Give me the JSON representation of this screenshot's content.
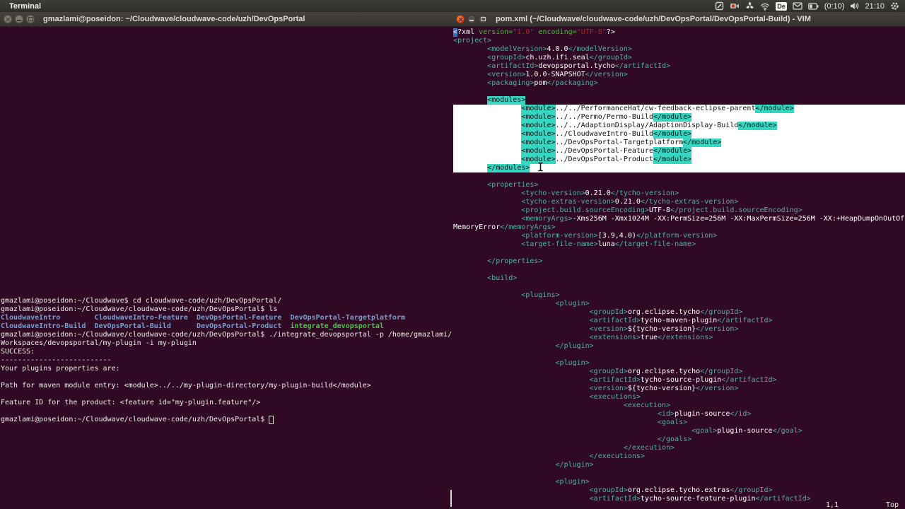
{
  "panel": {
    "app_name": "Terminal",
    "keyboard_layout": "De",
    "battery_time": "(0:10)",
    "clock": "21:10"
  },
  "colors": {
    "terminal_background": "#300a24",
    "panel_background": "#3e3c37",
    "selection_white": "#ffffff",
    "selection_cyan": "#35d7c2",
    "xml_tag_teal": "#4db3a4",
    "directory_blue": "#729fcf",
    "executable_green": "#3ecb3e",
    "attr_green": "#50b43e",
    "string_red": "#9e2b2b",
    "vim_cursor_blue": "#3d6fc0",
    "close_button_orange": "#d8451d"
  },
  "left_window": {
    "title": "gmazlami@poseidon: ~/Cloudwave/cloudwave-code/uzh/DevOpsPortal",
    "lines": [
      {
        "s": [
          [
            "p",
            "gmazlami@poseidon:~/Cloudwave$ cd cloudwave-code/uzh/DevOpsPortal/"
          ]
        ]
      },
      {
        "s": [
          [
            "p",
            "gmazlami@poseidon:~/Cloudwave/cloudwave-code/uzh/DevOpsPortal$ ls"
          ]
        ]
      },
      {
        "s": [
          [
            "d",
            "CloudwaveIntro"
          ],
          [
            "p",
            "        "
          ],
          [
            "d",
            "CloudwaveIntro-Feature"
          ],
          [
            "p",
            "  "
          ],
          [
            "d",
            "DevOpsPortal-Feature"
          ],
          [
            "p",
            "  "
          ],
          [
            "d",
            "DevOpsPortal-Targetplatform"
          ]
        ]
      },
      {
        "s": [
          [
            "d",
            "CloudwaveIntro-Build"
          ],
          [
            "p",
            "  "
          ],
          [
            "d",
            "DevOpsPortal-Build"
          ],
          [
            "p",
            "      "
          ],
          [
            "d",
            "DevOpsPortal-Product"
          ],
          [
            "p",
            "  "
          ],
          [
            "x",
            "integrate_devopsportal"
          ]
        ]
      },
      {
        "s": [
          [
            "p",
            "gmazlami@poseidon:~/Cloudwave/cloudwave-code/uzh/DevOpsPortal$ ./integrate_devopsportal -p /home/gmazlami/"
          ]
        ]
      },
      {
        "s": [
          [
            "p",
            "Workspaces/devopsportal/my-plugin -i my-plugin"
          ]
        ]
      },
      {
        "s": [
          [
            "p",
            "SUCCESS:"
          ]
        ]
      },
      {
        "s": [
          [
            "p",
            "--------------------------"
          ]
        ]
      },
      {
        "s": [
          [
            "p",
            "Your plugins properties are:"
          ]
        ]
      },
      {
        "s": []
      },
      {
        "s": [
          [
            "p",
            "Path for maven module entry: <module>../../my-plugin-directory/my-plugin-build</module>"
          ]
        ]
      },
      {
        "s": []
      },
      {
        "s": [
          [
            "p",
            "Feature ID for the product: <feature id=\"my-plugin.feature\"/>"
          ]
        ]
      },
      {
        "s": []
      },
      {
        "s": [
          [
            "p",
            "gmazlami@poseidon:~/Cloudwave/cloudwave-code/uzh/DevOpsPortal$ "
          ],
          [
            "hcur",
            ""
          ]
        ]
      }
    ]
  },
  "right_window": {
    "title": "pom.xml (~/Cloudwave/cloudwave-code/uzh/DevOpsPortal/DevOpsPortal-Build) - VIM",
    "status": {
      "cursor_pos": "1,1",
      "scroll_pos": "Top"
    },
    "lines": [
      {
        "s": [
          [
            "cur",
            "<"
          ],
          [
            "w",
            "?xml "
          ],
          [
            "g",
            "version="
          ],
          [
            "r",
            "\"1.0\""
          ],
          [
            "w",
            " "
          ],
          [
            "g",
            "encoding="
          ],
          [
            "r",
            "\"UTF-8\""
          ],
          [
            "w",
            "?>"
          ]
        ]
      },
      {
        "s": [
          [
            "t",
            "<project>"
          ]
        ]
      },
      {
        "s": [
          [
            "w",
            "        "
          ],
          [
            "t",
            "<modelVersion>"
          ],
          [
            "w",
            "4.0.0"
          ],
          [
            "t",
            "</modelVersion>"
          ]
        ]
      },
      {
        "s": [
          [
            "w",
            "        "
          ],
          [
            "t",
            "<groupId>"
          ],
          [
            "w",
            "ch.uzh.ifi.seal"
          ],
          [
            "t",
            "</groupId>"
          ]
        ]
      },
      {
        "s": [
          [
            "w",
            "        "
          ],
          [
            "t",
            "<artifactId>"
          ],
          [
            "w",
            "devopsportal.tycho"
          ],
          [
            "t",
            "</artifactId>"
          ]
        ]
      },
      {
        "s": [
          [
            "w",
            "        "
          ],
          [
            "t",
            "<version>"
          ],
          [
            "w",
            "1.0.0-SNAPSHOT"
          ],
          [
            "t",
            "</version>"
          ]
        ]
      },
      {
        "s": [
          [
            "w",
            "        "
          ],
          [
            "t",
            "<packaging>"
          ],
          [
            "w",
            "pom"
          ],
          [
            "t",
            "</packaging>"
          ]
        ]
      },
      {
        "s": []
      },
      {
        "s": [
          [
            "w",
            "        "
          ],
          [
            "st",
            "<modules>"
          ],
          [
            "fillsel",
            ""
          ]
        ]
      },
      {
        "cls": "sel",
        "s": [
          [
            "sw",
            "                "
          ],
          [
            "st",
            "<module>"
          ],
          [
            "sw",
            "../../PerformanceHat/cw-feedback-eclipse-parent"
          ],
          [
            "st",
            "</module>"
          ]
        ]
      },
      {
        "cls": "sel",
        "s": [
          [
            "sw",
            "                "
          ],
          [
            "st",
            "<module>"
          ],
          [
            "sw",
            "../../Permo/Permo-Build"
          ],
          [
            "st",
            "</module>"
          ]
        ]
      },
      {
        "cls": "sel",
        "s": [
          [
            "sw",
            "                "
          ],
          [
            "st",
            "<module>"
          ],
          [
            "sw",
            "../../AdaptionDisplay/AdaptionDisplay-Build"
          ],
          [
            "st",
            "</module>"
          ]
        ]
      },
      {
        "cls": "sel",
        "s": [
          [
            "sw",
            "                "
          ],
          [
            "st",
            "<module>"
          ],
          [
            "sw",
            "../CloudwaveIntro-Build"
          ],
          [
            "st",
            "</module>"
          ]
        ]
      },
      {
        "cls": "sel",
        "s": [
          [
            "sw",
            "                "
          ],
          [
            "st",
            "<module>"
          ],
          [
            "sw",
            "../DevOpsPortal-Targetplatform"
          ],
          [
            "st",
            "</module>"
          ]
        ]
      },
      {
        "cls": "sel",
        "s": [
          [
            "sw",
            "                "
          ],
          [
            "st",
            "<module>"
          ],
          [
            "sw",
            "../DevOpsPortal-Feature"
          ],
          [
            "st",
            "</module>"
          ]
        ]
      },
      {
        "cls": "sel",
        "s": [
          [
            "sw",
            "                "
          ],
          [
            "st",
            "<module>"
          ],
          [
            "sw",
            "../DevOpsPortal-Product"
          ],
          [
            "st",
            "</module>"
          ]
        ]
      },
      {
        "cls": "sel",
        "s": [
          [
            "sw",
            "        "
          ],
          [
            "st",
            "</modules>"
          ]
        ]
      },
      {
        "s": []
      },
      {
        "s": [
          [
            "w",
            "        "
          ],
          [
            "t",
            "<properties>"
          ]
        ]
      },
      {
        "s": [
          [
            "w",
            "                "
          ],
          [
            "t",
            "<tycho-version>"
          ],
          [
            "w",
            "0.21.0"
          ],
          [
            "t",
            "</tycho-version>"
          ]
        ]
      },
      {
        "s": [
          [
            "w",
            "                "
          ],
          [
            "t",
            "<tycho-extras-version>"
          ],
          [
            "w",
            "0.21.0"
          ],
          [
            "t",
            "</tycho-extras-version>"
          ]
        ]
      },
      {
        "s": [
          [
            "w",
            "                "
          ],
          [
            "t",
            "<project.build.sourceEncoding>"
          ],
          [
            "w",
            "UTF-8"
          ],
          [
            "t",
            "</project.build.sourceEncoding>"
          ]
        ]
      },
      {
        "s": [
          [
            "w",
            "                "
          ],
          [
            "t",
            "<memoryArgs>"
          ],
          [
            "w",
            "-Xms256M -Xmx1024M -XX:PermSize=256M -XX:MaxPermSize=256M -XX:+HeapDumpOnOutOf"
          ]
        ]
      },
      {
        "s": [
          [
            "w",
            "MemoryError"
          ],
          [
            "t",
            "</memoryArgs>"
          ]
        ]
      },
      {
        "s": [
          [
            "w",
            "                "
          ],
          [
            "t",
            "<platform-version>"
          ],
          [
            "w",
            "[3.9,4.0)"
          ],
          [
            "t",
            "</platform-version>"
          ]
        ]
      },
      {
        "s": [
          [
            "w",
            "                "
          ],
          [
            "t",
            "<target-file-name>"
          ],
          [
            "w",
            "luna"
          ],
          [
            "t",
            "</target-file-name>"
          ]
        ]
      },
      {
        "s": []
      },
      {
        "s": [
          [
            "w",
            "        "
          ],
          [
            "t",
            "</properties>"
          ]
        ]
      },
      {
        "s": []
      },
      {
        "s": [
          [
            "w",
            "        "
          ],
          [
            "t",
            "<build>"
          ]
        ]
      },
      {
        "s": []
      },
      {
        "s": [
          [
            "w",
            "                "
          ],
          [
            "t",
            "<plugins>"
          ]
        ]
      },
      {
        "s": [
          [
            "w",
            "                        "
          ],
          [
            "t",
            "<plugin>"
          ]
        ]
      },
      {
        "s": [
          [
            "w",
            "                                "
          ],
          [
            "t",
            "<groupId>"
          ],
          [
            "w",
            "org.eclipse.tycho"
          ],
          [
            "t",
            "</groupId>"
          ]
        ]
      },
      {
        "s": [
          [
            "w",
            "                                "
          ],
          [
            "t",
            "<artifactId>"
          ],
          [
            "w",
            "tycho-maven-plugin"
          ],
          [
            "t",
            "</artifactId>"
          ]
        ]
      },
      {
        "s": [
          [
            "w",
            "                                "
          ],
          [
            "t",
            "<version>"
          ],
          [
            "w",
            "${tycho-version}"
          ],
          [
            "t",
            "</version>"
          ]
        ]
      },
      {
        "s": [
          [
            "w",
            "                                "
          ],
          [
            "t",
            "<extensions>"
          ],
          [
            "w",
            "true"
          ],
          [
            "t",
            "</extensions>"
          ]
        ]
      },
      {
        "s": [
          [
            "w",
            "                        "
          ],
          [
            "t",
            "</plugin>"
          ]
        ]
      },
      {
        "s": []
      },
      {
        "s": [
          [
            "w",
            "                        "
          ],
          [
            "t",
            "<plugin>"
          ]
        ]
      },
      {
        "s": [
          [
            "w",
            "                                "
          ],
          [
            "t",
            "<groupId>"
          ],
          [
            "w",
            "org.eclipse.tycho"
          ],
          [
            "t",
            "</groupId>"
          ]
        ]
      },
      {
        "s": [
          [
            "w",
            "                                "
          ],
          [
            "t",
            "<artifactId>"
          ],
          [
            "w",
            "tycho-source-plugin"
          ],
          [
            "t",
            "</artifactId>"
          ]
        ]
      },
      {
        "s": [
          [
            "w",
            "                                "
          ],
          [
            "t",
            "<version>"
          ],
          [
            "w",
            "${tycho-version}"
          ],
          [
            "t",
            "</version>"
          ]
        ]
      },
      {
        "s": [
          [
            "w",
            "                                "
          ],
          [
            "t",
            "<executions>"
          ]
        ]
      },
      {
        "s": [
          [
            "w",
            "                                        "
          ],
          [
            "t",
            "<execution>"
          ]
        ]
      },
      {
        "s": [
          [
            "w",
            "                                                "
          ],
          [
            "t",
            "<id>"
          ],
          [
            "w",
            "plugin-source"
          ],
          [
            "t",
            "</id>"
          ]
        ]
      },
      {
        "s": [
          [
            "w",
            "                                                "
          ],
          [
            "t",
            "<goals>"
          ]
        ]
      },
      {
        "s": [
          [
            "w",
            "                                                        "
          ],
          [
            "t",
            "<goal>"
          ],
          [
            "w",
            "plugin-source"
          ],
          [
            "t",
            "</goal>"
          ]
        ]
      },
      {
        "s": [
          [
            "w",
            "                                                "
          ],
          [
            "t",
            "</goals>"
          ]
        ]
      },
      {
        "s": [
          [
            "w",
            "                                        "
          ],
          [
            "t",
            "</execution>"
          ]
        ]
      },
      {
        "s": [
          [
            "w",
            "                                "
          ],
          [
            "t",
            "</executions>"
          ]
        ]
      },
      {
        "s": [
          [
            "w",
            "                        "
          ],
          [
            "t",
            "</plugin>"
          ]
        ]
      },
      {
        "s": []
      },
      {
        "s": [
          [
            "w",
            "                        "
          ],
          [
            "t",
            "<plugin>"
          ]
        ]
      },
      {
        "s": [
          [
            "w",
            "                                "
          ],
          [
            "t",
            "<groupId>"
          ],
          [
            "w",
            "org.eclipse.tycho.extras"
          ],
          [
            "t",
            "</groupId>"
          ]
        ]
      },
      {
        "s": [
          [
            "w",
            "                                "
          ],
          [
            "t",
            "<artifactId>"
          ],
          [
            "w",
            "tycho-source-feature-plugin"
          ],
          [
            "t",
            "</artifactId>"
          ]
        ]
      }
    ]
  }
}
